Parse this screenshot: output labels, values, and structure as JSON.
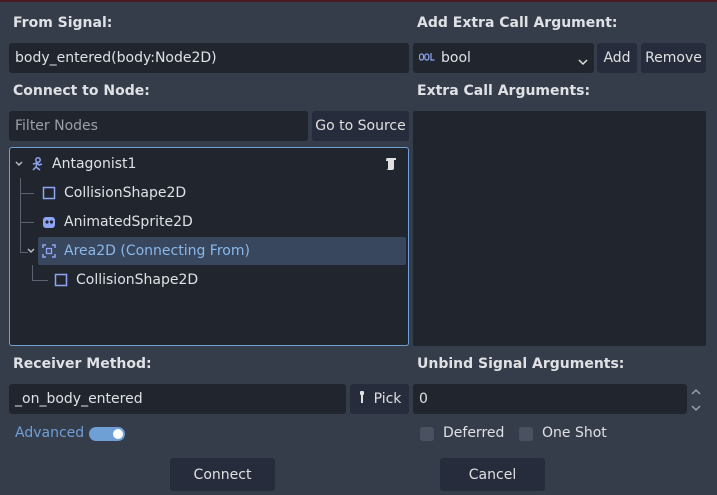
{
  "left": {
    "from_signal_label": "From Signal:",
    "from_signal_value": "body_entered(body:Node2D)",
    "connect_to_node_label": "Connect to Node:",
    "filter_placeholder": "Filter Nodes",
    "go_to_source": "Go to Source",
    "tree": [
      {
        "label": "Antagonist1",
        "icon": "character-body-icon"
      },
      {
        "label": "CollisionShape2D",
        "icon": "collision-shape-icon"
      },
      {
        "label": "AnimatedSprite2D",
        "icon": "animated-sprite-icon"
      },
      {
        "label": "Area2D (Connecting From)",
        "icon": "area2d-icon"
      },
      {
        "label": "CollisionShape2D",
        "icon": "collision-shape-icon"
      }
    ],
    "receiver_method_label": "Receiver Method:",
    "receiver_method_value": "_on_body_entered",
    "pick_label": "Pick",
    "advanced_label": "Advanced"
  },
  "right": {
    "add_extra_label": "Add Extra Call Argument:",
    "type_selected": "bool",
    "add_label": "Add",
    "remove_label": "Remove",
    "extra_args_label": "Extra Call Arguments:",
    "unbind_label": "Unbind Signal Arguments:",
    "unbind_value": "0",
    "deferred_label": "Deferred",
    "one_shot_label": "One Shot"
  },
  "footer": {
    "connect_label": "Connect",
    "cancel_label": "Cancel"
  },
  "colors": {
    "background": "#363d4a",
    "field": "#21262e",
    "accent": "#6ea0d6",
    "selected_row": "#38475e"
  }
}
